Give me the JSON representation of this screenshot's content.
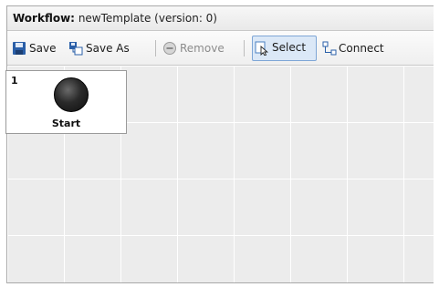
{
  "window": {
    "title_label": "Workflow:",
    "title_value": "newTemplate (version: 0)"
  },
  "toolbar": {
    "save_label": "Save",
    "save_as_label": "Save As",
    "remove_label": "Remove",
    "select_label": "Select",
    "connect_label": "Connect",
    "icons": {
      "save": "floppy-disk-icon",
      "save_as": "save-as-icon",
      "remove": "remove-icon",
      "select": "select-pointer-icon",
      "connect": "connect-icon"
    }
  },
  "node": {
    "index": "1",
    "label": "Start"
  },
  "colors": {
    "active_tool_bg": "#dbe8f7",
    "active_tool_border": "#7ea6d6",
    "save_icon_blue": "#2a5fa8"
  }
}
